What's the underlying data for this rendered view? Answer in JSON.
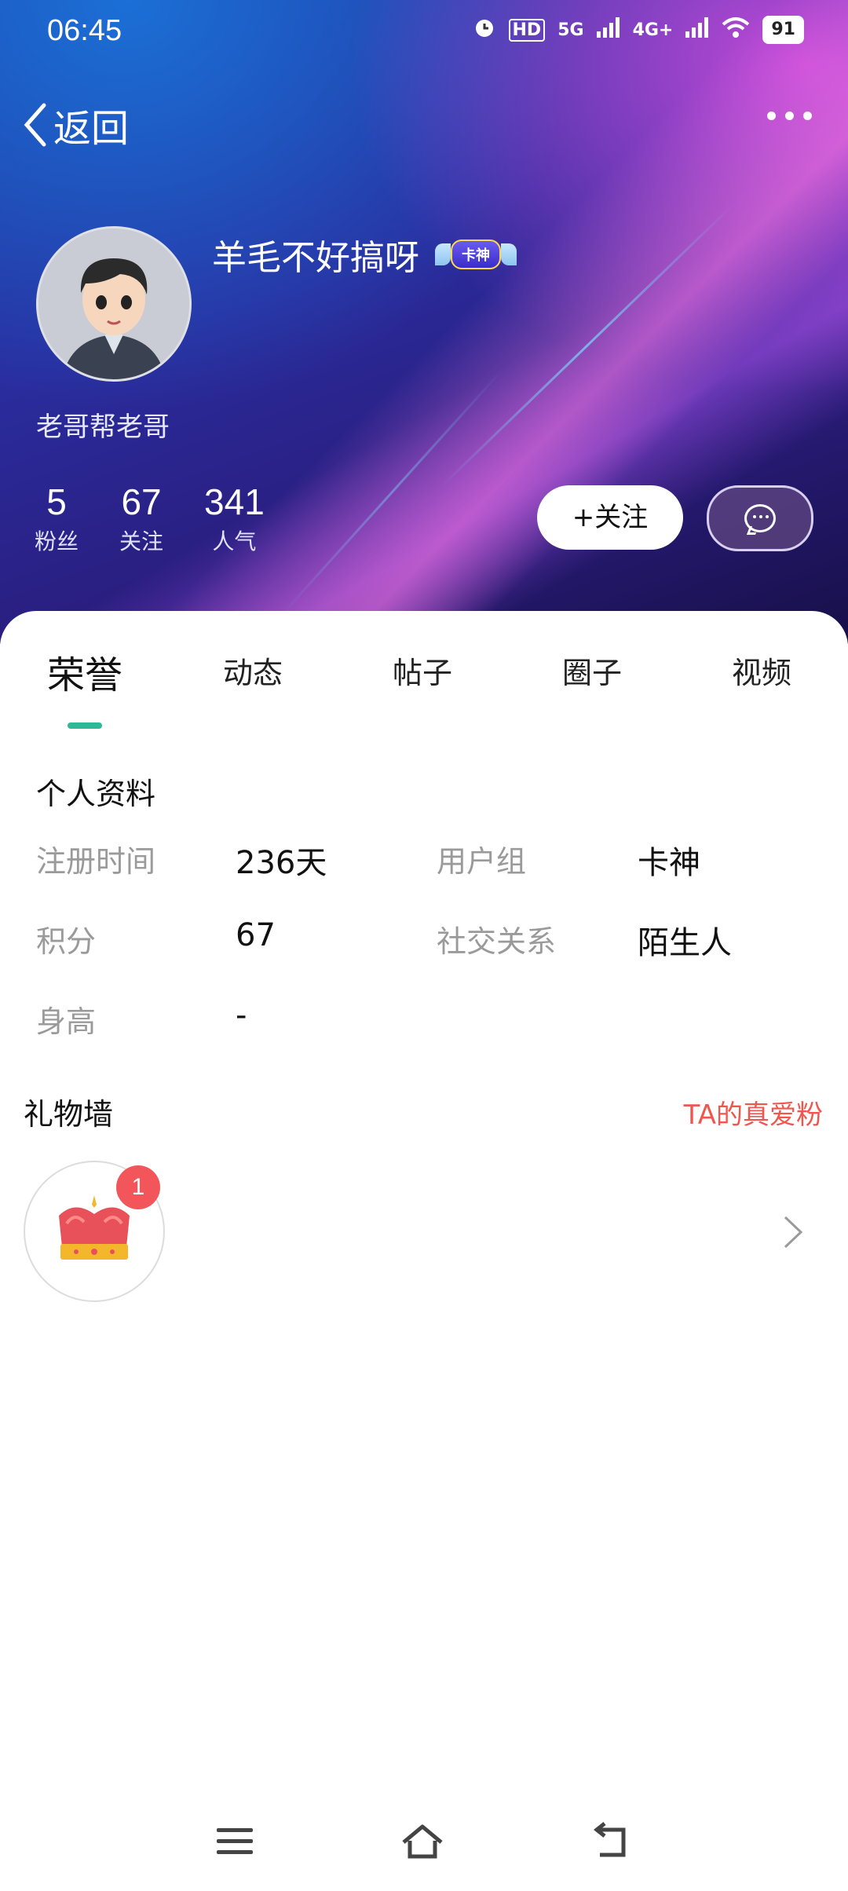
{
  "status_bar": {
    "time": "06:45",
    "icons": [
      "alarm-icon",
      "hd-icon",
      "5g-signal-icon",
      "4g-signal-icon",
      "wifi-icon"
    ],
    "hd_label": "HD",
    "net1": "5G",
    "net2": "4G+",
    "battery": "91"
  },
  "nav": {
    "back_label": "返回"
  },
  "profile": {
    "nickname": "羊毛不好搞呀",
    "badge_label": "卡神",
    "subtitle": "老哥帮老哥",
    "stats": [
      {
        "value": "5",
        "label": "粉丝"
      },
      {
        "value": "67",
        "label": "关注"
      },
      {
        "value": "341",
        "label": "人气"
      }
    ],
    "follow_label": "+关注"
  },
  "tabs": [
    {
      "label": "荣誉",
      "active": true
    },
    {
      "label": "动态"
    },
    {
      "label": "帖子"
    },
    {
      "label": "圈子"
    },
    {
      "label": "视频"
    }
  ],
  "personal_info": {
    "title": "个人资料",
    "rows": [
      {
        "label": "注册时间",
        "value": "236天"
      },
      {
        "label": "用户组",
        "value": "卡神"
      },
      {
        "label": "积分",
        "value": "67"
      },
      {
        "label": "社交关系",
        "value": "陌生人"
      },
      {
        "label": "身高",
        "value": "-"
      }
    ]
  },
  "gift_wall": {
    "title": "礼物墙",
    "link": "TA的真爱粉",
    "gift_icon": "crown-icon",
    "count": "1"
  },
  "colors": {
    "accent_green": "#2fb896",
    "link_red": "#f0564e",
    "badge_red": "#f2555a"
  }
}
